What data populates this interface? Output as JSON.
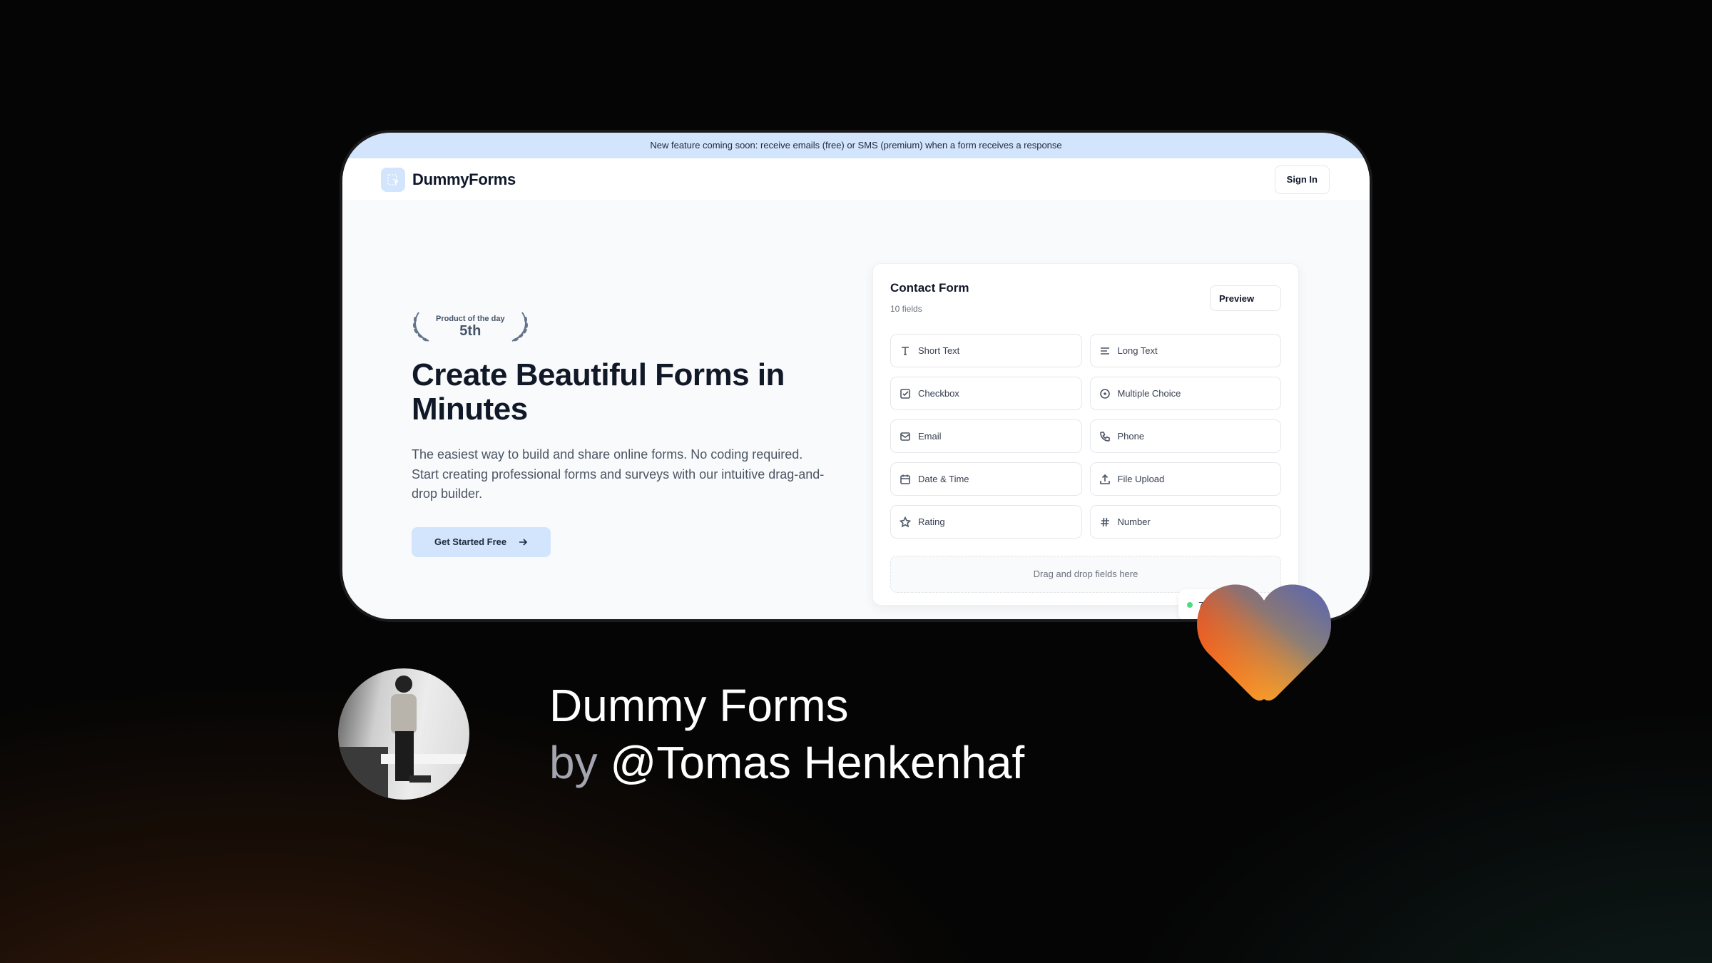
{
  "banner": {
    "text": "New feature coming soon: receive emails (free) or SMS (premium) when a form receives a response"
  },
  "nav": {
    "brand": "DummyForms",
    "sign_in": "Sign In"
  },
  "hero": {
    "award_label": "Product of the day",
    "award_rank": "5th",
    "heading": "Create Beautiful Forms in Minutes",
    "description": "The easiest way to build and share online forms. No coding required. Start creating professional forms and surveys with our intuitive drag-and-drop builder.",
    "cta": "Get Started Free"
  },
  "form_card": {
    "title": "Contact Form",
    "subtitle": "10 fields",
    "preview": "Preview",
    "fields": [
      {
        "label": "Short Text",
        "icon": "type-icon"
      },
      {
        "label": "Long Text",
        "icon": "align-left-icon"
      },
      {
        "label": "Checkbox",
        "icon": "checkbox-icon"
      },
      {
        "label": "Multiple Choice",
        "icon": "radio-icon"
      },
      {
        "label": "Email",
        "icon": "mail-icon"
      },
      {
        "label": "Phone",
        "icon": "phone-icon"
      },
      {
        "label": "Date & Time",
        "icon": "calendar-icon"
      },
      {
        "label": "File Upload",
        "icon": "upload-icon"
      },
      {
        "label": "Rating",
        "icon": "star-icon"
      },
      {
        "label": "Number",
        "icon": "hash-icon"
      }
    ],
    "dropzone": "Drag and drop fields here",
    "status_text": "7"
  },
  "showcase": {
    "title": "Dummy Forms",
    "by": "by",
    "author": "@Tomas Henkenhaf"
  },
  "colors": {
    "accent": "#d3e5fc",
    "status": "#4ade80",
    "heart_start": "#e8391e",
    "heart_mid": "#f59e2c",
    "heart_end": "#5b66b0"
  }
}
